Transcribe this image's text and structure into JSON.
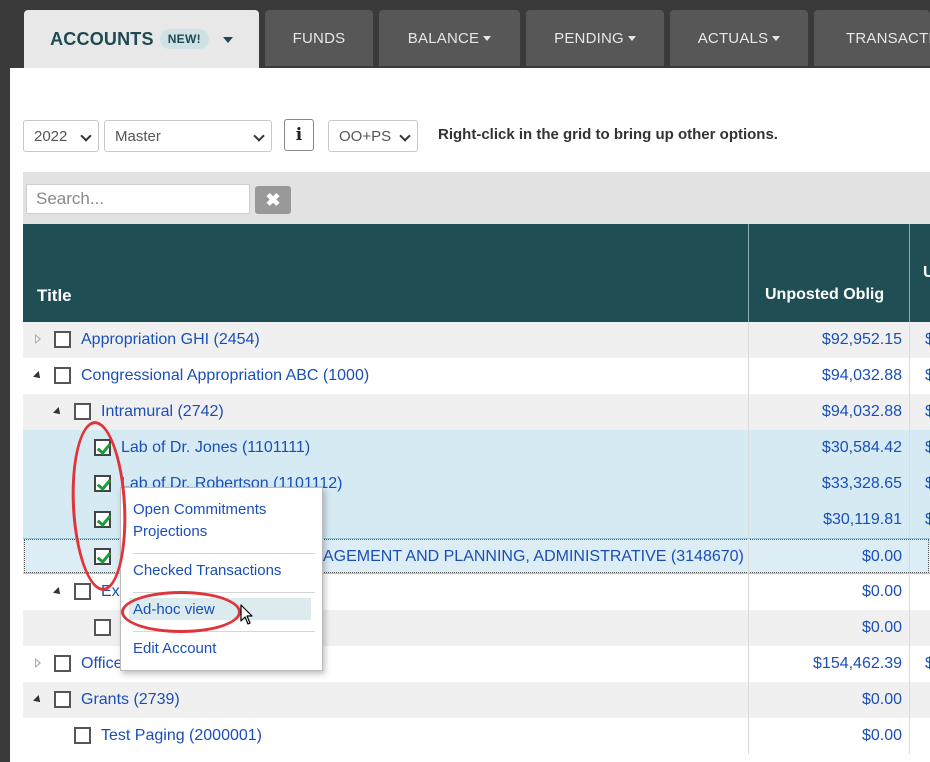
{
  "nav": {
    "tabs": [
      {
        "label": "ACCOUNTS",
        "badge": "NEW!"
      },
      {
        "label": "FUNDS"
      },
      {
        "label": "BALANCE"
      },
      {
        "label": "PENDING"
      },
      {
        "label": "ACTUALS"
      },
      {
        "label": "TRANSACTIONS"
      }
    ]
  },
  "toolbar": {
    "year": "2022",
    "version": "Master",
    "info_label": "i",
    "filter": "OO+PS",
    "hint": "Right-click in the grid to bring up other options."
  },
  "search": {
    "placeholder": "Search...",
    "clear_label": "✖"
  },
  "grid": {
    "columns": {
      "title": "Title",
      "unposted": "Unposted Oblig",
      "next": "U"
    },
    "rows": [
      {
        "title": "Appropriation GHI (2454)",
        "amount": "$92,952.15",
        "amount2": "$"
      },
      {
        "title": "Congressional Appropriation ABC (1000)",
        "amount": "$94,032.88",
        "amount2": "$"
      },
      {
        "title": "Intramural (2742)",
        "amount": "$94,032.88",
        "amount2": "$"
      },
      {
        "title": "Lab of Dr. Jones (1101111)",
        "amount": "$30,584.42",
        "amount2": "$"
      },
      {
        "title": "Lab of Dr. Robertson (1101112)",
        "amount": "$33,328.65",
        "amount2": "$"
      },
      {
        "title": "",
        "amount": "$30,119.81",
        "amount2": "$"
      },
      {
        "title": "AGEMENT AND PLANNING, ADMINISTRATIVE (3148670)",
        "amount": "$0.00",
        "amount2": ""
      },
      {
        "title": "Ex",
        "amount": "$0.00",
        "amount2": ""
      },
      {
        "title": "",
        "amount": "$0.00",
        "amount2": ""
      },
      {
        "title": "Office",
        "amount": "$154,462.39",
        "amount2": "$"
      },
      {
        "title": "Grants (2739)",
        "amount": "$0.00",
        "amount2": ""
      },
      {
        "title": "Test Paging (2000001)",
        "amount": "$0.00",
        "amount2": ""
      }
    ]
  },
  "context_menu": {
    "items": [
      "Open Commitments",
      "Projections",
      "Checked Transactions",
      "Ad-hoc view",
      "Edit Account"
    ]
  },
  "colors": {
    "accent": "#1f4f55",
    "link": "#1a4fb8",
    "annotation": "#e0343a"
  }
}
